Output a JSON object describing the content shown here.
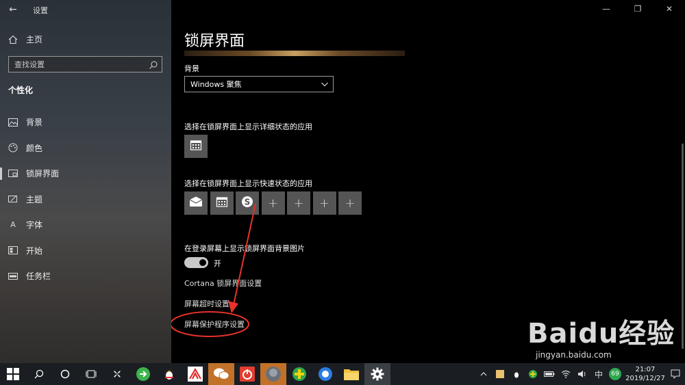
{
  "window": {
    "app_title": "设置",
    "back_glyph": "←",
    "minimize_glyph": "—",
    "maximize_glyph": "❐",
    "close_glyph": "✕"
  },
  "sidebar": {
    "home_label": "主页",
    "search_placeholder": "查找设置",
    "section_title": "个性化",
    "items": [
      {
        "label": "背景",
        "icon": "picture-icon"
      },
      {
        "label": "颜色",
        "icon": "palette-icon"
      },
      {
        "label": "锁屏界面",
        "icon": "lock-screen-icon",
        "active": true
      },
      {
        "label": "主题",
        "icon": "theme-icon"
      },
      {
        "label": "字体",
        "icon": "font-icon"
      },
      {
        "label": "开始",
        "icon": "start-icon"
      },
      {
        "label": "任务栏",
        "icon": "taskbar-icon"
      }
    ]
  },
  "main": {
    "page_title": "锁屏界面",
    "background_label": "背景",
    "background_value": "Windows 聚焦",
    "detail_status_label": "选择在锁屏界面上显示详细状态的应用",
    "quick_status_label": "选择在锁屏界面上显示快速状态的应用",
    "plus_glyph": "+",
    "lock_bg_label": "在登录屏幕上显示锁屏界面背景图片",
    "toggle_state": "开",
    "toggle_on": true,
    "link_cortana": "Cortana 锁屏界面设置",
    "link_timeout": "屏幕超时设置",
    "link_screensaver": "屏幕保护程序设置"
  },
  "watermark": {
    "brand": "Baidu经验",
    "url": "jingyan.baidu.com"
  },
  "taskbar": {
    "ime_label": "中",
    "badge_count": "69",
    "time": "21:07",
    "date": "2019/12/27"
  },
  "colors": {
    "annotation_red": "#e8322a",
    "tile_gray": "#555555",
    "taskbar_bg": "#1a1e22"
  }
}
